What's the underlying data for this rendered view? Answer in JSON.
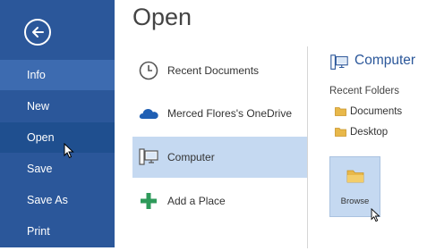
{
  "nav": {
    "items": [
      {
        "label": "Info"
      },
      {
        "label": "New"
      },
      {
        "label": "Open"
      },
      {
        "label": "Save"
      },
      {
        "label": "Save As"
      },
      {
        "label": "Print"
      }
    ]
  },
  "page": {
    "title": "Open"
  },
  "places": [
    {
      "label": "Recent Documents",
      "icon": "clock-icon"
    },
    {
      "label": "Merced Flores's OneDrive",
      "icon": "onedrive-cloud-icon"
    },
    {
      "label": "Computer",
      "icon": "computer-icon"
    },
    {
      "label": "Add a Place",
      "icon": "plus-icon"
    }
  ],
  "computer_panel": {
    "title": "Computer",
    "recent_folders_label": "Recent Folders",
    "folders": [
      {
        "label": "Documents"
      },
      {
        "label": "Desktop"
      }
    ],
    "browse_label": "Browse"
  },
  "colors": {
    "nav_bg": "#2b579a",
    "selected_place_bg": "#c5d9f1",
    "accent": "#2b579a",
    "folder": "#e8b84a"
  }
}
